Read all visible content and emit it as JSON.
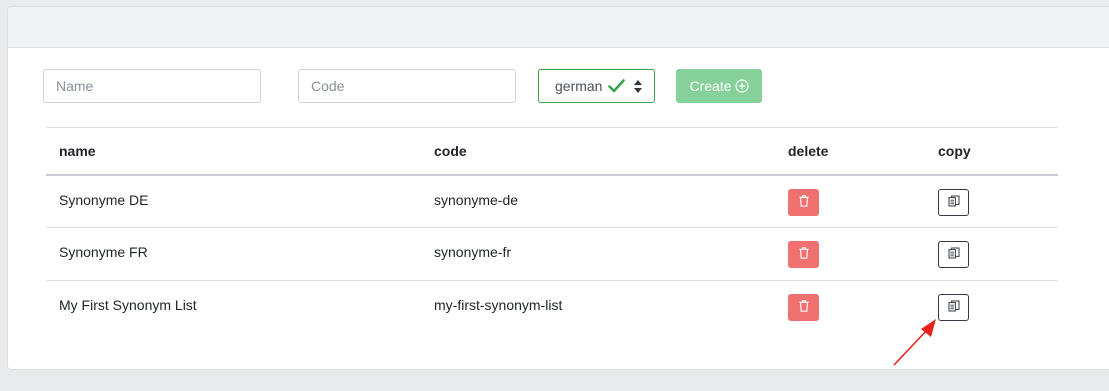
{
  "form": {
    "name_placeholder": "Name",
    "code_placeholder": "Code",
    "language_selected": "german",
    "create_label": "Create"
  },
  "table": {
    "headers": [
      "name",
      "code",
      "delete",
      "copy"
    ],
    "rows": [
      {
        "name": "Synonyme DE",
        "code": "synonyme-de"
      },
      {
        "name": "Synonyme FR",
        "code": "synonyme-fr"
      },
      {
        "name": "My First Synonym List",
        "code": "my-first-synonym-list"
      }
    ]
  },
  "icons": {
    "language_valid": "check-icon",
    "select_arrows": "sort-arrows-icon",
    "create": "plus-circle-icon",
    "delete": "trash-icon",
    "copy": "copy-icon"
  },
  "colors": {
    "success": "#38a34b",
    "create_button": "#86d19a",
    "danger": "#f07070",
    "annotation_arrow": "#e8231f"
  }
}
